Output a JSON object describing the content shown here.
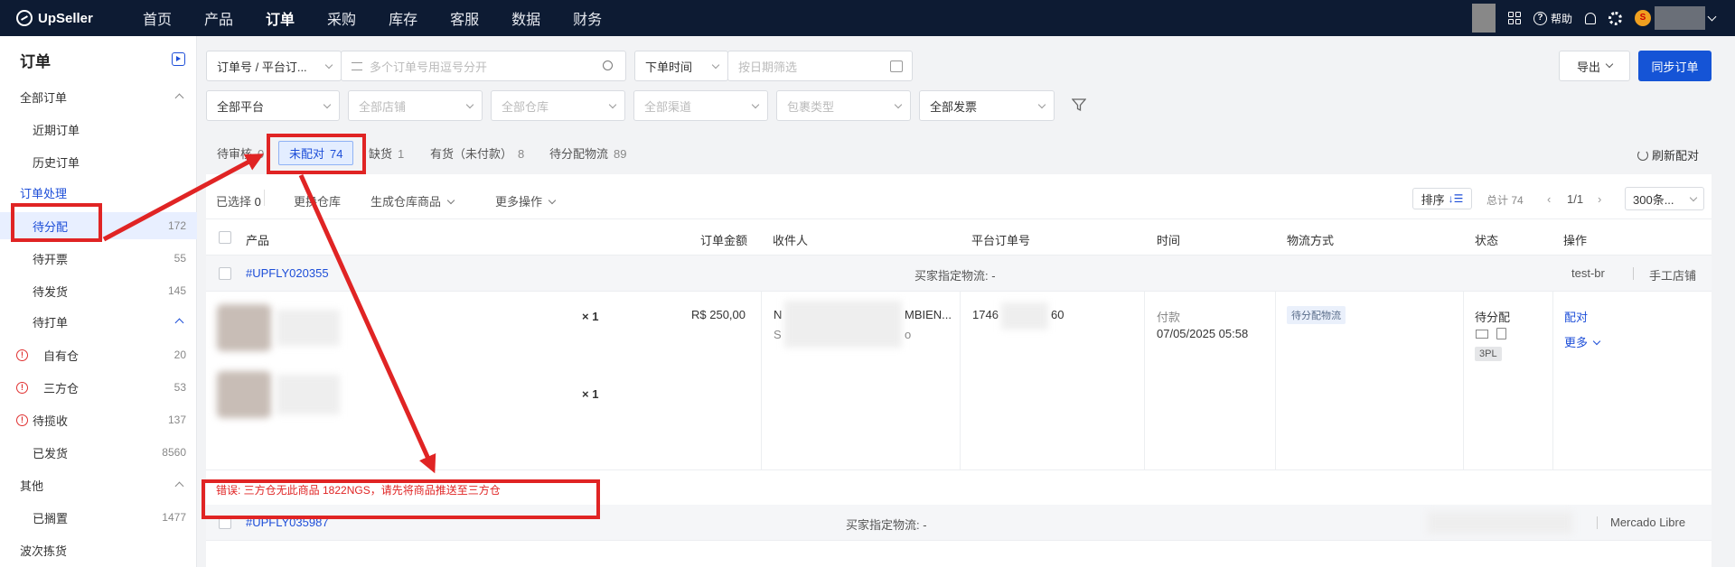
{
  "topnav": {
    "logo": "UpSeller",
    "items": [
      "首页",
      "产品",
      "订单",
      "采购",
      "库存",
      "客服",
      "数据",
      "财务"
    ],
    "help": "帮助",
    "avatar_letter": "S"
  },
  "sidebar": {
    "title": "订单",
    "all_orders": "全部订单",
    "recent": "近期订单",
    "history": "历史订单",
    "processing": "订单处理",
    "to_assign": {
      "label": "待分配",
      "count": "172"
    },
    "to_invoice": {
      "label": "待开票",
      "count": "55"
    },
    "to_ship": {
      "label": "待发货",
      "count": "145"
    },
    "to_print": "待打单",
    "own_wh": {
      "label": "自有仓",
      "count": "20"
    },
    "third_wh": {
      "label": "三方仓",
      "count": "53"
    },
    "to_collect": {
      "label": "待揽收",
      "count": "137"
    },
    "shipped": {
      "label": "已发货",
      "count": "8560"
    },
    "other": "其他",
    "shelved": {
      "label": "已搁置",
      "count": "1477"
    },
    "wave": "波次拣货"
  },
  "filters": {
    "order_type": "订单号 / 平台订...",
    "search_placeholder": "多个订单号用逗号分开",
    "time_type": "下单时间",
    "date_placeholder": "按日期筛选",
    "platform": "全部平台",
    "store": "全部店铺",
    "warehouse": "全部仓库",
    "channel": "全部渠道",
    "package": "包裹类型",
    "invoice": "全部发票",
    "export": "导出",
    "sync": "同步订单"
  },
  "tabs": [
    {
      "label": "待审核",
      "count": "0"
    },
    {
      "label": "未配对",
      "count": "74"
    },
    {
      "label": "缺货",
      "count": "1"
    },
    {
      "label": "有货（未付款）",
      "count": "8"
    },
    {
      "label": "待分配物流",
      "count": "89"
    }
  ],
  "refresh": "刷新配对",
  "toolbar": {
    "selected": "已选择",
    "selected_count": "0",
    "change_wh": "更换仓库",
    "gen_wh_product": "生成仓库商品",
    "more_ops": "更多操作",
    "sort": "排序",
    "total": "总计 74",
    "page": "1/1",
    "page_size": "300条..."
  },
  "columns": [
    "产品",
    "订单金额",
    "收件人",
    "平台订单号",
    "时间",
    "物流方式",
    "状态",
    "操作"
  ],
  "orders": [
    {
      "id": "#UPFLY020355",
      "buyer_logistics": "买家指定物流: -",
      "store": "test-br",
      "store_type": "手工店铺",
      "qty1": "× 1",
      "qty2": "× 1",
      "amount": "R$ 250,00",
      "recipient": "N",
      "recipient_tail": "MBIEN...",
      "recipient2": "S",
      "recipient2_tail": "o",
      "platform_no_a": "1746",
      "platform_no_b": "60",
      "time_label": "付款",
      "time": "07/05/2025 05:58",
      "logistics": "待分配物流",
      "status": "待分配",
      "status_tag": "3PL",
      "action_match": "配对",
      "action_more": "更多"
    },
    {
      "id": "#UPFLY035987",
      "buyer_logistics": "买家指定物流: -",
      "store_type": "Mercado Libre"
    }
  ],
  "error": "错误: 三方仓无此商品 1822NGS，请先将商品推送至三方仓",
  "colors": {
    "accent": "#1554d6",
    "annotation": "#e02424",
    "topbar": "#0d1b33"
  }
}
